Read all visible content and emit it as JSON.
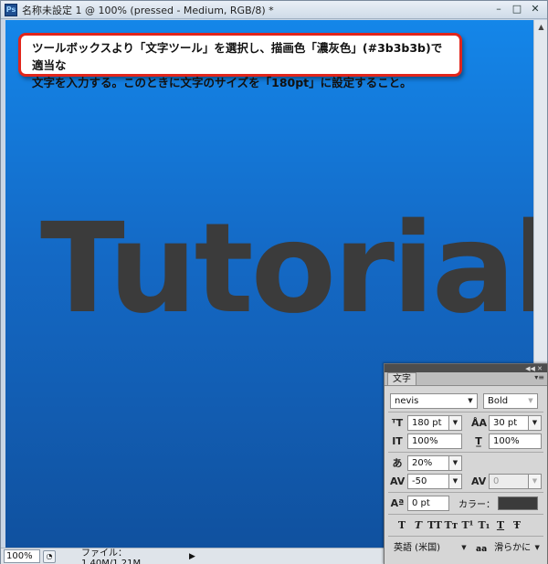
{
  "window": {
    "app_icon": "Ps",
    "title": "名称未設定 1 @ 100% (pressed - Medium, RGB/8) *",
    "controls": {
      "minimize": "–",
      "maximize": "□",
      "close": "✕"
    }
  },
  "canvas": {
    "callout_line1": "ツールボックスより「文字ツール」を選択し、描画色「濃灰色」(#3b3b3b)で適当な",
    "callout_line2": "文字を入力する。このときに文字のサイズを「180pt」に設定すること。",
    "sample_text": "Tutorial",
    "text_color": "#3b3b3b",
    "gradient_top": "#1486e9",
    "gradient_bottom": "#10519f",
    "callout_border": "#e1251b"
  },
  "statusbar": {
    "zoom": "100%",
    "file_info": "ファイル：1.40M/1.21M",
    "arrow": "▶"
  },
  "panel": {
    "tab": "文字",
    "font_family": "nevis",
    "font_style": "Bold",
    "font_size": "180 pt",
    "leading": "30 pt",
    "vertical_scale": "100%",
    "horizontal_scale": "100%",
    "tsume": "20%",
    "kerning": "-50",
    "tracking": "0",
    "baseline_shift": "0 pt",
    "color_label": "カラー：",
    "color": "#3b3b3b",
    "language": "英語 (米国)",
    "antialias_icon": "aa",
    "antialias": "滑らかに",
    "style_buttons": [
      "T",
      "T",
      "TT",
      "Tт",
      "T¹",
      "T₁",
      "T",
      "Ŧ"
    ]
  }
}
